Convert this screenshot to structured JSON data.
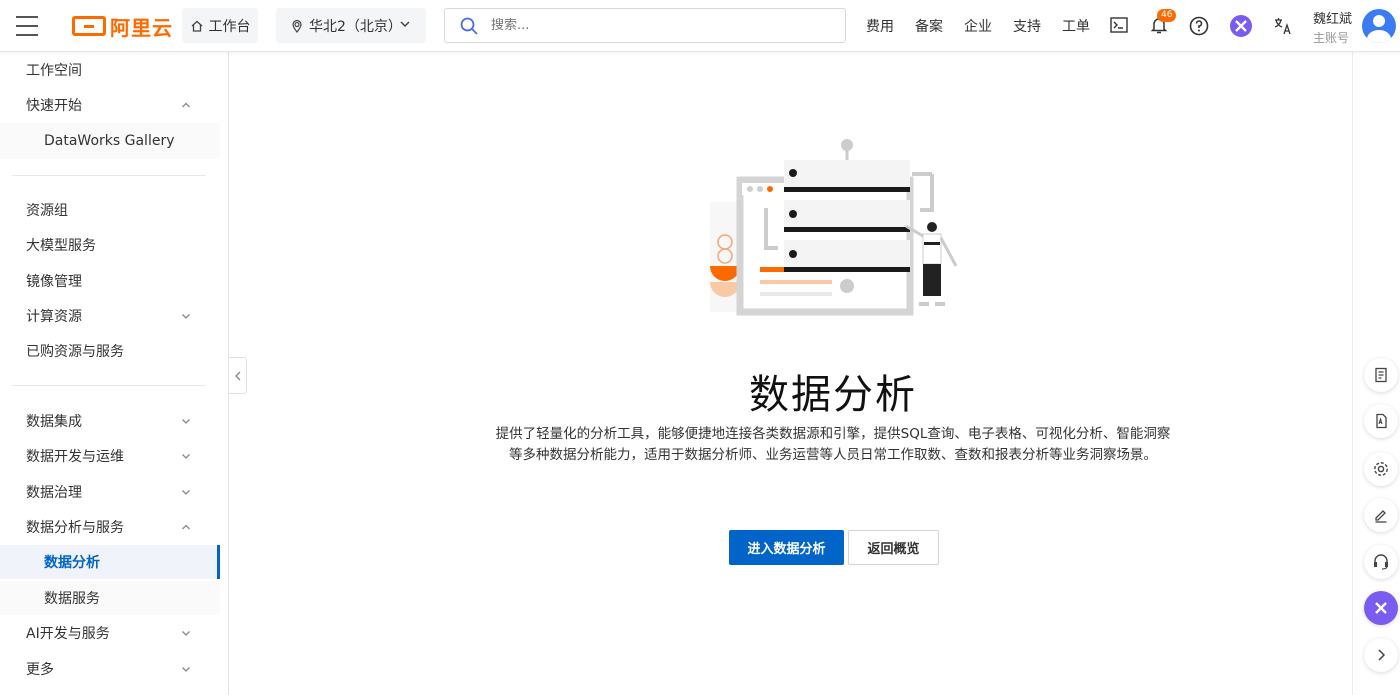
{
  "header": {
    "logo_text": "阿里云",
    "workbench_label": "工作台",
    "region_label": "华北2（北京）",
    "search_placeholder": "搜索...",
    "nav": [
      "费用",
      "备案",
      "企业",
      "支持",
      "工单"
    ],
    "notification_count": "46",
    "user_name": "魏红斌",
    "user_role": "主账号"
  },
  "sidebar": {
    "items": [
      {
        "label": "工作空间"
      },
      {
        "label": "快速开始"
      },
      {
        "label": "DataWorks Gallery"
      },
      {
        "label": "资源组"
      },
      {
        "label": "大模型服务"
      },
      {
        "label": "镜像管理"
      },
      {
        "label": "计算资源"
      },
      {
        "label": "已购资源与服务"
      },
      {
        "label": "数据集成"
      },
      {
        "label": "数据开发与运维"
      },
      {
        "label": "数据治理"
      },
      {
        "label": "数据分析与服务"
      },
      {
        "label": "数据分析"
      },
      {
        "label": "数据服务"
      },
      {
        "label": "AI开发与服务"
      },
      {
        "label": "更多"
      }
    ]
  },
  "main": {
    "title": "数据分析",
    "description_line1": "提供了轻量化的分析工具，能够便捷地连接各类数据源和引擎，提供SQL查询、电子表格、可视化分析、智能洞察",
    "description_line2": "等多种数据分析能力，适用于数据分析师、业务运营等人员日常工作取数、查数和报表分析等业务洞察场景。",
    "primary_button": "进入数据分析",
    "secondary_button": "返回概览"
  },
  "colors": {
    "brand_orange": "#ff6a00",
    "primary_blue": "#0064c8"
  }
}
